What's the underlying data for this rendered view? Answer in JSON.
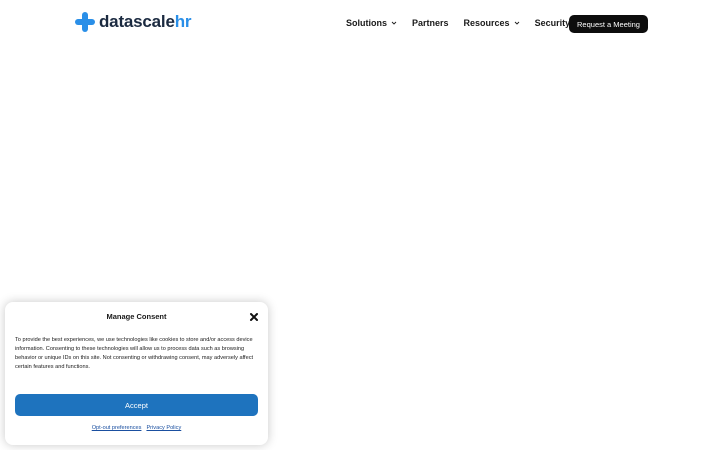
{
  "brand": {
    "name_main": "datascale",
    "name_accent": "hr",
    "icon": "plus-logo-icon",
    "colors": {
      "dark": "#1b2a40",
      "accent": "#2a8fe8"
    }
  },
  "nav": {
    "items": [
      {
        "label": "Solutions",
        "has_dropdown": true
      },
      {
        "label": "Partners",
        "has_dropdown": false
      },
      {
        "label": "Resources",
        "has_dropdown": true
      },
      {
        "label": "Security",
        "has_dropdown": false
      }
    ],
    "cta_label": "Request a Meeting"
  },
  "consent": {
    "title": "Manage Consent",
    "close_icon": "close-icon",
    "body": "To provide the best experiences, we use technologies like cookies to store and/or access device information. Consenting to these technologies will allow us to process data such as browsing behavior or unique IDs on this site. Not consenting or withdrawing consent, may adversely affect certain features and functions.",
    "accept_label": "Accept",
    "links": {
      "opt_out": "Opt-out preferences",
      "privacy": "Privacy Policy"
    },
    "colors": {
      "accept": "#1e73be",
      "link": "#1a4fa0"
    }
  }
}
